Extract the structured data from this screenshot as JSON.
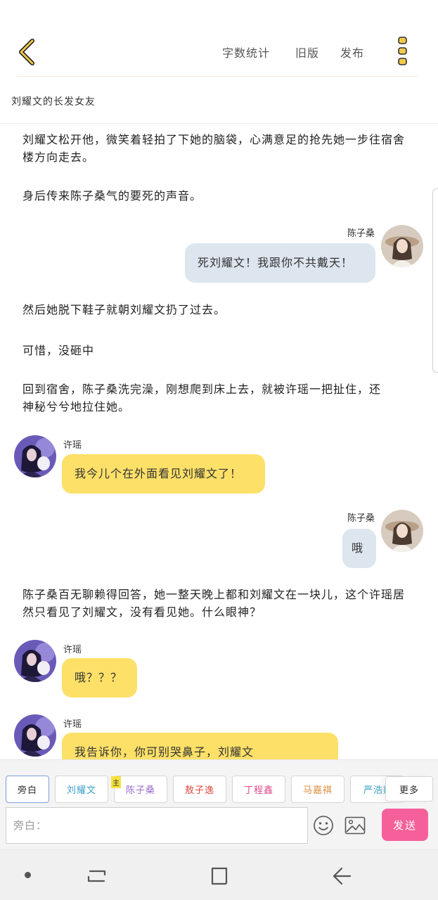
{
  "header": {
    "back_icon": "back-chevron-icon",
    "actions": [
      "字数统计",
      "旧版",
      "发布"
    ],
    "menu_icon": "vertical-dots-menu-icon",
    "accent_color": "#f2c94c"
  },
  "story": {
    "title": "刘耀文的长发女友"
  },
  "messages": [
    {
      "type": "narration",
      "text": "刘耀文松开他，微笑着轻拍了下她的脑袋，心满意足的抢先她一步往宿舍楼方向走去。"
    },
    {
      "type": "narration",
      "text": "身后传来陈子桑气的要死的声音。"
    },
    {
      "type": "right",
      "name": "陈子桑",
      "text": "死刘耀文！我跟你不共戴天！",
      "avatar": "girl-with-hat-avatar"
    },
    {
      "type": "narration",
      "text": "然后她脱下鞋子就朝刘耀文扔了过去。"
    },
    {
      "type": "narration",
      "text": "可惜，没砸中"
    },
    {
      "type": "narration",
      "text": "回到宿舍，陈子桑洗完澡，刚想爬到床上去，就被许瑶一把扯住，还神秘兮兮地拉住她。"
    },
    {
      "type": "left",
      "name": "许瑶",
      "text": "我今儿个在外面看见刘耀文了！",
      "avatar": "girl-with-plush-avatar"
    },
    {
      "type": "right",
      "name": "陈子桑",
      "text": "哦",
      "avatar": "girl-with-hat-avatar"
    },
    {
      "type": "narration",
      "text": "陈子桑百无聊赖得回答，她一整天晚上都和刘耀文在一块儿，这个许瑶居然只看见了刘耀文，没有看见她。什么眼神？"
    },
    {
      "type": "left",
      "name": "许瑶",
      "text": "哦？？？",
      "avatar": "girl-with-plush-avatar"
    },
    {
      "type": "left",
      "name": "许瑶",
      "text": "我告诉你，你可别哭鼻子，刘耀文",
      "avatar": "girl-with-plush-avatar"
    }
  ],
  "characters": [
    {
      "label": "旁白",
      "color": "#333333",
      "selected": true
    },
    {
      "label": "刘耀文",
      "color": "#3aa0c8"
    },
    {
      "label": "陈子桑",
      "color": "#9a6ad0",
      "tag": "主"
    },
    {
      "label": "敖子逸",
      "color": "#e0483a"
    },
    {
      "label": "丁程鑫",
      "color": "#e04a8a"
    },
    {
      "label": "马嘉祺",
      "color": "#e08a3a"
    },
    {
      "label": "严浩翔",
      "color": "#3aa0c8"
    }
  ],
  "more_label": "更多",
  "input": {
    "placeholder": "旁白：",
    "emoji_icon": "emoji-icon",
    "image_icon": "image-icon",
    "send_label": "发送",
    "send_color": "#f5609a"
  },
  "nav": {
    "dot_icon": "nav-dot-icon",
    "recent_icon": "recent-apps-icon",
    "home_icon": "home-icon",
    "back_icon": "nav-back-icon"
  }
}
